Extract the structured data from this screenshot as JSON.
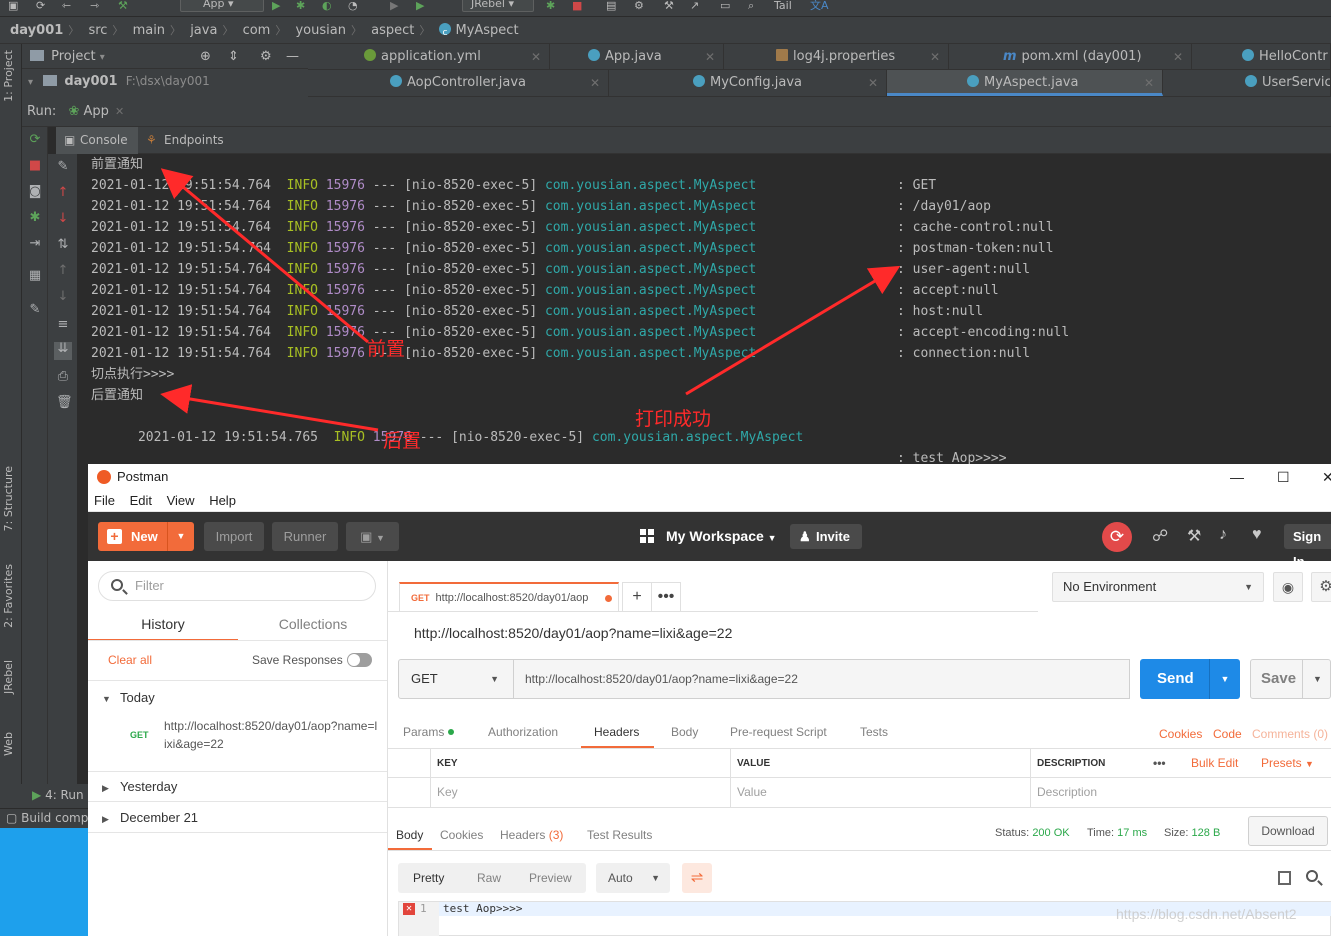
{
  "ide": {
    "toolbar": {
      "run_config": "App",
      "jrebel": "JRebel",
      "tail": "Tail"
    },
    "breadcrumb": [
      "day001",
      "src",
      "main",
      "java",
      "com",
      "yousian",
      "aspect",
      "MyAspect"
    ],
    "left_tabs": [
      "1: Project",
      "7: Structure",
      "2: Favorites",
      "JRebel",
      "Web"
    ],
    "project_panel": {
      "title": "Project",
      "root_name": "day001",
      "root_path": "F:\\dsx\\day001"
    },
    "editor_tabs_row1": [
      "application.yml",
      "App.java",
      "log4j.properties",
      "pom.xml (day001)",
      "HelloContr"
    ],
    "editor_tabs_row2": [
      "AopController.java",
      "MyConfig.java",
      "MyAspect.java",
      "UserService"
    ],
    "active_tab": "MyAspect.java",
    "run": {
      "label": "Run:",
      "config": "App"
    },
    "console_tabs": [
      "Console",
      "Endpoints"
    ],
    "bottom": {
      "run_tab": "4: Run",
      "build_text": "Build comp"
    },
    "console": {
      "prefix": "2021-01-12 19:51:54.764",
      "level": "INFO",
      "pid": "15976",
      "sep": "---",
      "thread": "[nio-8520-exec-5]",
      "logger": "com.yousian.aspect.MyAspect",
      "line_before": "前置通知",
      "messages": [
        ": GET",
        ": /day01/aop",
        ": cache-control:null",
        ": postman-token:null",
        ": user-agent:null",
        ": accept:null",
        ": host:null",
        ": accept-encoding:null",
        ": connection:null"
      ],
      "line_join": "切点执行>>>>",
      "line_after": "后置通知",
      "last_prefix": "2021-01-12 19:51:54.765",
      "last_msg": ": test Aop>>>>"
    },
    "annotations": {
      "before": "前置",
      "after": "后置",
      "printed": "打印成功"
    }
  },
  "postman": {
    "window_title": "Postman",
    "menu": [
      "File",
      "Edit",
      "View",
      "Help"
    ],
    "header": {
      "new": "New",
      "import": "Import",
      "runner": "Runner",
      "workspace": "My Workspace",
      "invite": "Invite",
      "sign_in": "Sign In"
    },
    "sidebar": {
      "filter_placeholder": "Filter",
      "tabs": [
        "History",
        "Collections"
      ],
      "clear_all": "Clear all",
      "save_responses": "Save Responses",
      "groups": [
        "Today",
        "Yesterday",
        "December 21"
      ],
      "history_item": {
        "method": "GET",
        "url": "http://localhost:8520/day01/aop?name=lixi&age=22"
      }
    },
    "request": {
      "tab_method": "GET",
      "tab_url": "http://localhost:8520/day01/aop",
      "name": "http://localhost:8520/day01/aop?name=lixi&age=22",
      "method": "GET",
      "url": "http://localhost:8520/day01/aop?name=lixi&age=22",
      "send": "Send",
      "save": "Save",
      "environment": "No Environment",
      "tabs": [
        "Params",
        "Authorization",
        "Headers",
        "Body",
        "Pre-request Script",
        "Tests"
      ],
      "active_tab": "Headers",
      "cookies": "Cookies",
      "code": "Code",
      "comments": "Comments (0)",
      "table_headers": [
        "KEY",
        "VALUE",
        "DESCRIPTION"
      ],
      "bulk_edit": "Bulk Edit",
      "presets": "Presets",
      "placeholders": [
        "Key",
        "Value",
        "Description"
      ]
    },
    "response": {
      "tabs": [
        "Body",
        "Cookies",
        "Headers",
        "Test Results"
      ],
      "headers_count": "(3)",
      "status_label": "Status:",
      "status": "200 OK",
      "time_label": "Time:",
      "time": "17 ms",
      "size_label": "Size:",
      "size": "128 B",
      "download": "Download",
      "view_modes": [
        "Pretty",
        "Raw",
        "Preview"
      ],
      "format": "Auto",
      "line_number": "1",
      "body_text": "test Aop>>>>"
    }
  },
  "watermark": "https://blog.csdn.net/Absent2"
}
